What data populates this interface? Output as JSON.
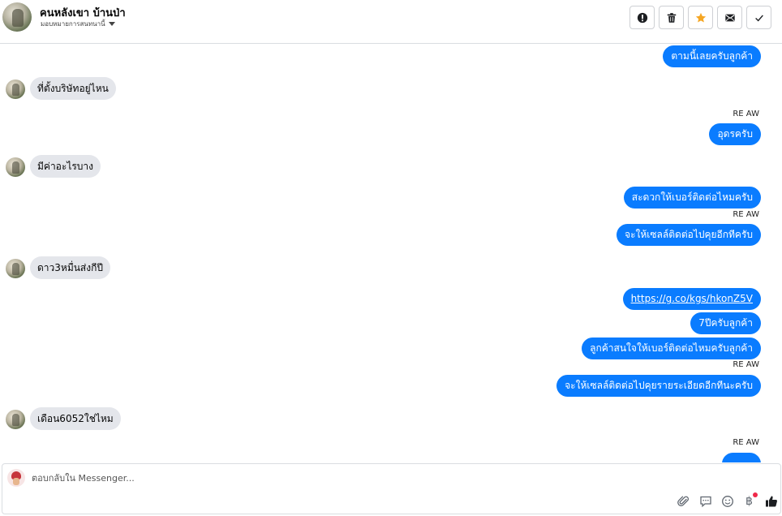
{
  "header": {
    "name": "คนหลังเขา บ้านป่า",
    "subtitle": "มอบหมายการสนทนานี้",
    "actions": [
      {
        "name": "report-spam-button",
        "icon": "alert-icon"
      },
      {
        "name": "delete-button",
        "icon": "trash-icon"
      },
      {
        "name": "star-button",
        "icon": "star-icon"
      },
      {
        "name": "mark-unread-button",
        "icon": "mail-icon"
      },
      {
        "name": "mark-done-button",
        "icon": "check-icon"
      }
    ]
  },
  "messages": {
    "m1": "ตามนี้เลยครับลูกค้า",
    "m2": "ที่ตั้งบริษัทอยู่ไหน",
    "sender1": "RE AW",
    "m3": "อุดรครับ",
    "m4": "มีค่าอะไรบาง",
    "m5": "สะดวกให้เบอร์ติดต่อไหมครับ",
    "sender2": "RE AW",
    "m6": "จะให้เซลล์ติดต่อไปคุยอีกทีครับ",
    "m7": "ดาว3หมื่นส่งกีปี",
    "m8": "https://g.co/kgs/hkonZ5V",
    "m9": "7ปีครับลูกค้า",
    "m10": "ลูกค้าสนใจให้เบอร์ติดต่อไหมครับลูกค้า",
    "sender3": "RE AW",
    "m11": "จะให้เซลล์ติดต่อไปคุยรายระเอียดอีกทีนะครับ",
    "m12": "เดือน6052ใช่ไหม",
    "sender4": "RE AW"
  },
  "composer": {
    "placeholder": "ตอบกลับใน Messenger...",
    "baht": "฿"
  },
  "colors": {
    "outgoing": "#0a7cff",
    "incoming": "#e4e6eb",
    "star": "#f5a623"
  }
}
